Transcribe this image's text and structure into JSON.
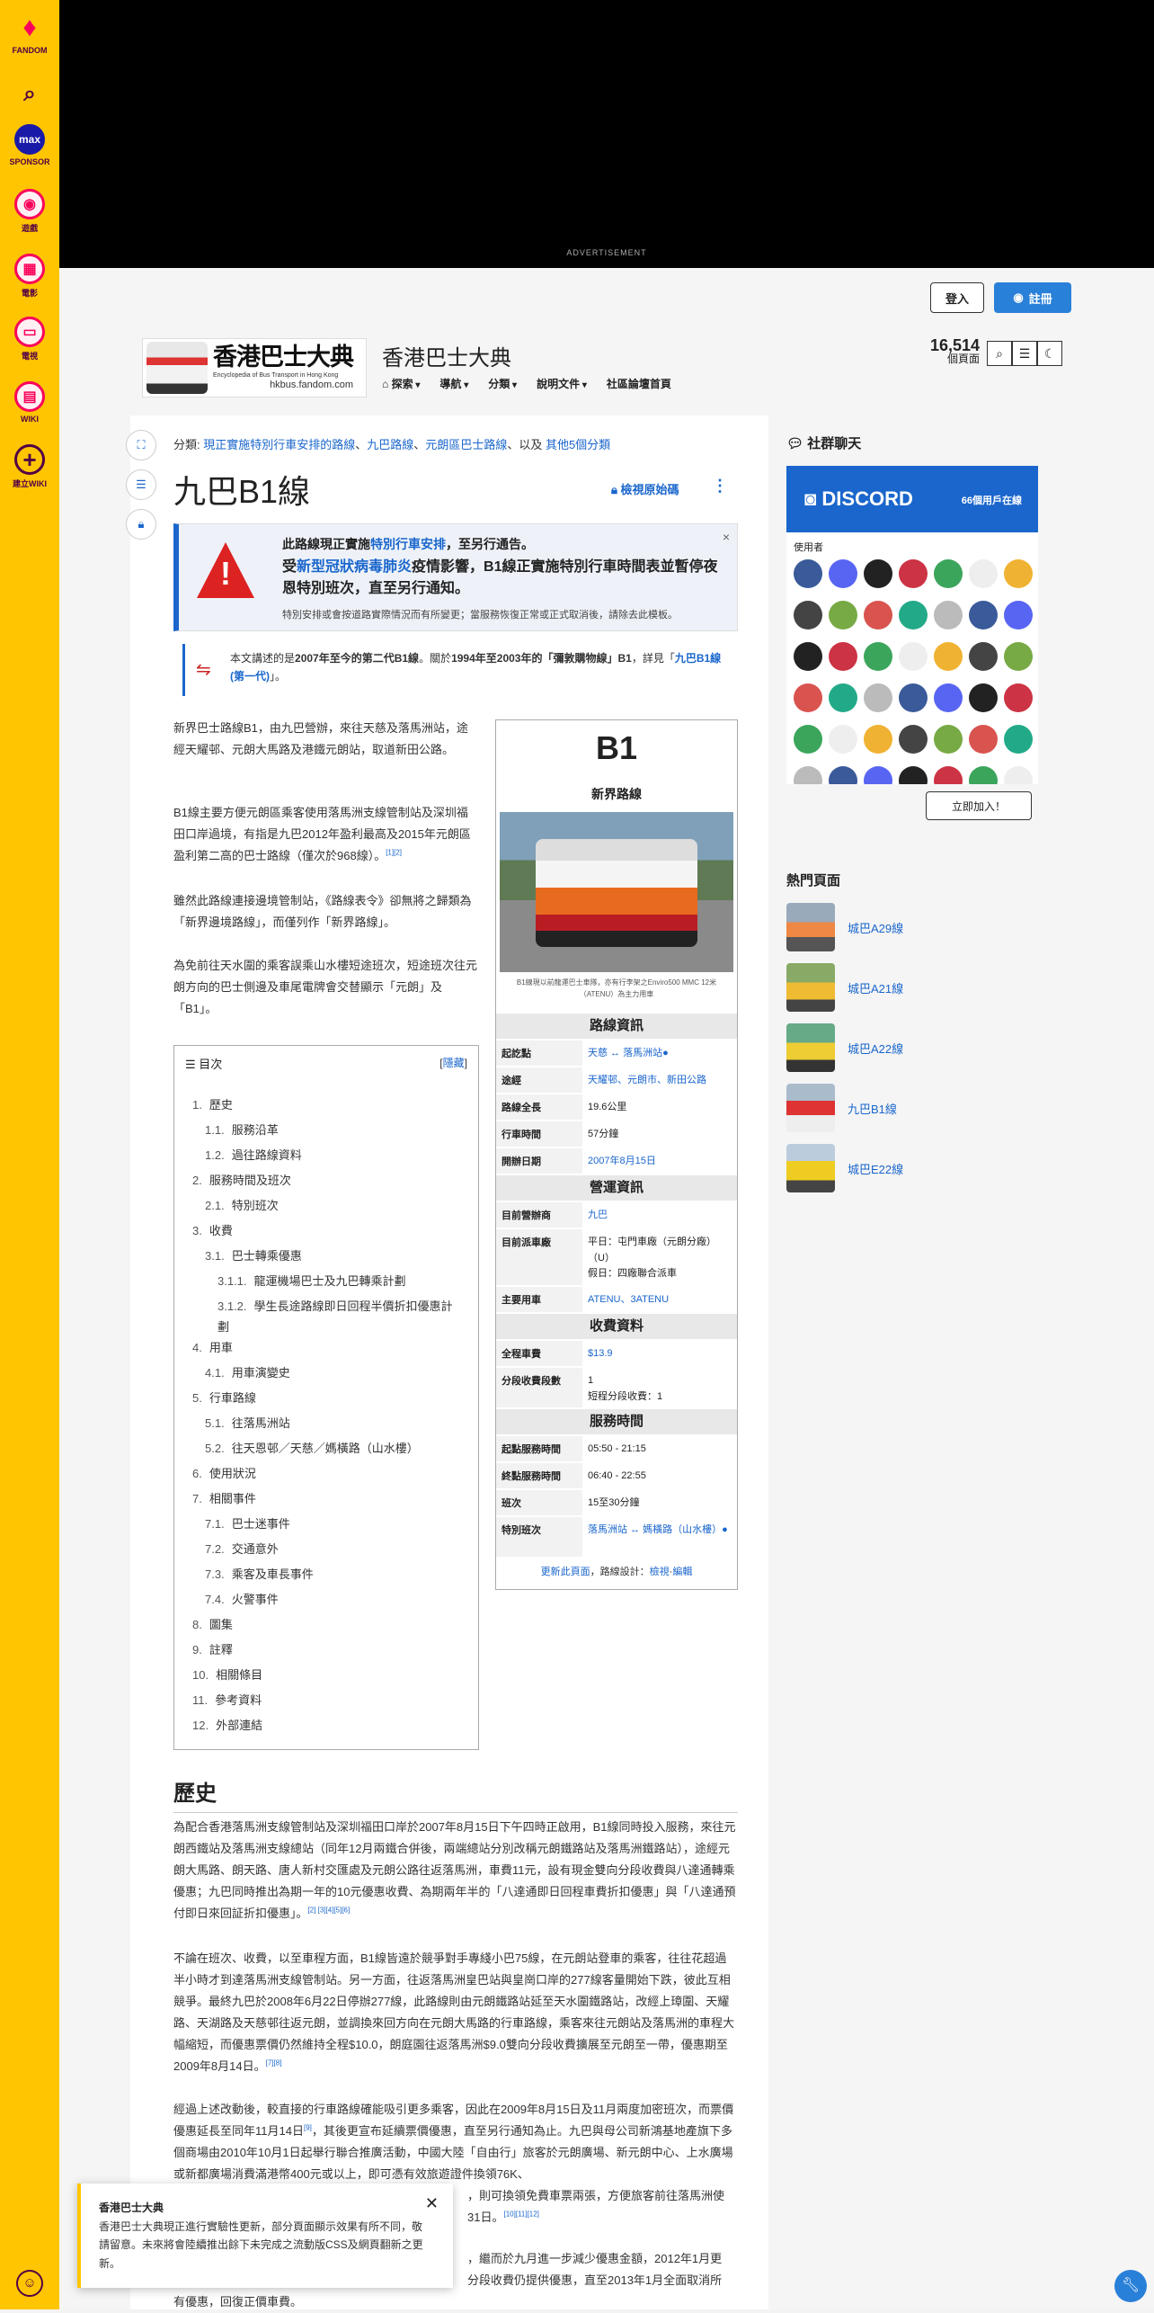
{
  "rail": {
    "fandom": "FANDOM",
    "sponsor": "SPONSOR",
    "max_logo": "max",
    "games": "遊戲",
    "movies": "電影",
    "tv": "電視",
    "wiki": "WIKI",
    "create_wiki": "建立WIKI"
  },
  "ad": {
    "label": "ADVERTISEMENT"
  },
  "header": {
    "login": "登入",
    "register": "註冊",
    "wiki_name": "香港巴士大典",
    "logo_title": "香港巴士大典",
    "logo_subtitle": "Encyclopedia of Bus Transport in Hong Kong",
    "logo_domain": "hkbus.fandom.com",
    "page_count": "16,514",
    "page_count_label": "個頁面",
    "nav": [
      "探索",
      "導航",
      "分類",
      "說明文件",
      "社區論壇首頁"
    ]
  },
  "page": {
    "categories_label": "分類:",
    "categories": [
      "現正實施特別行車安排的路線",
      "九巴路線",
      "元朗區巴士路線"
    ],
    "categories_sep": "、",
    "categories_more_prefix": "、以及 ",
    "categories_more": "其他5個分類",
    "title": "九巴B1線",
    "view_source": "檢視原始碼",
    "more": "⋮"
  },
  "notice": {
    "line1_pre": "此路線現正實施",
    "line1_link": "特別行車安排",
    "line1_post": "，至另行通告。",
    "line2_pre": "受",
    "line2_link": "新型冠狀病毒肺炎",
    "line2_post": "疫情影響，B1線正實施特別行車時間表並暫停夜恩特別班次，直至另行通知。",
    "line3": "特別安排或會按道路實際情況而有所變更；當服務恢復正常或正式取消後，請除去此模板。",
    "close": "×"
  },
  "hatnote": {
    "pre": "本文講述的是",
    "b1": "2007年至今的第二代B1線",
    "mid": "。關於",
    "b2": "1994年至2003年的「彌敦購物線」B1",
    "post": "，詳見「",
    "link": "九巴B1線 (第一代)",
    "end": "」。"
  },
  "intro": {
    "p1": "新界巴士路線B1，由九巴營辦，來往天慈及落馬洲站，途經天耀邨、元朗大馬路及港鐵元朗站，取道新田公路。",
    "p2": "B1線主要方便元朗區乘客使用落馬洲支線管制站及深圳福田口岸過境，有指是九巴2012年盈利最高及2015年元朗區盈利第二高的巴士路線（僅次於968線）。",
    "p2_sup": "[1][2]",
    "p3": "雖然此路線連接邊境管制站，《路線表令》卻無將之歸類為「新界邊境路線」，而僅列作「新界路線」。",
    "p4": "為免前往天水圍的乘客誤乘山水樓短途班次，短途班次往元朗方向的巴士側邊及車尾電牌會交替顯示「元朗」及「B1」。"
  },
  "infobox": {
    "title": "B1",
    "subtitle": "新界路線",
    "caption": "B1線現以前龍運巴士車隊，亦有行李架之Enviro500 MMC 12米（ATENU）為主力用車",
    "sec_route": "路線資訊",
    "sec_ops": "營運資訊",
    "sec_fare": "收費資料",
    "sec_time": "服務時間",
    "rows_route": [
      {
        "k": "起訖點",
        "v": "天慈 ↔ 落馬洲站●"
      },
      {
        "k": "途經",
        "v": "天耀邨、元朗市、新田公路"
      },
      {
        "k": "路線全長",
        "v": "19.6公里"
      },
      {
        "k": "行車時間",
        "v": "57分鐘"
      },
      {
        "k": "開辦日期",
        "v": "2007年8月15日"
      }
    ],
    "rows_ops": [
      {
        "k": "目前營辦商",
        "v": "九巴"
      },
      {
        "k": "目前派車廠",
        "v": "平日：屯門車廠（元朗分廠）（U）\n假日：四廠聯合派車"
      },
      {
        "k": "主要用車",
        "v": "ATENU、3ATENU"
      }
    ],
    "rows_fare": [
      {
        "k": "全程車費",
        "v": "$13.9"
      },
      {
        "k": "分段收費段數",
        "v": "1\n短程分段收費：1"
      }
    ],
    "rows_time": [
      {
        "k": "起點服務時間",
        "v": "05:50 - 21:15"
      },
      {
        "k": "終點服務時間",
        "v": "06:40 - 22:55"
      },
      {
        "k": "班次",
        "v": "15至30分鐘"
      },
      {
        "k": "特別班次",
        "v": "落馬洲站 ↔ 媽橫路（山水樓）●"
      }
    ],
    "foot_link": "更新此頁面",
    "foot_mid": "，路線設計：",
    "foot_view": "檢視",
    "foot_sep": "·",
    "foot_edit": "編輯"
  },
  "toc": {
    "title": "目次",
    "hide": "隱藏",
    "items": [
      {
        "n": "1.",
        "t": "歷史",
        "lvl": 0
      },
      {
        "n": "1.1.",
        "t": "服務沿革",
        "lvl": 1
      },
      {
        "n": "1.2.",
        "t": "過往路線資料",
        "lvl": 1
      },
      {
        "n": "2.",
        "t": "服務時間及班次",
        "lvl": 0
      },
      {
        "n": "2.1.",
        "t": "特別班次",
        "lvl": 1
      },
      {
        "n": "3.",
        "t": "收費",
        "lvl": 0
      },
      {
        "n": "3.1.",
        "t": "巴士轉乘優惠",
        "lvl": 1
      },
      {
        "n": "3.1.1.",
        "t": "龍運機場巴士及九巴轉乘計劃",
        "lvl": 2
      },
      {
        "n": "3.1.2.",
        "t": "學生長途路線即日回程半價折扣優惠計劃",
        "lvl": 2
      },
      {
        "n": "4.",
        "t": "用車",
        "lvl": 0
      },
      {
        "n": "4.1.",
        "t": "用車演變史",
        "lvl": 1
      },
      {
        "n": "5.",
        "t": "行車路線",
        "lvl": 0
      },
      {
        "n": "5.1.",
        "t": "往落馬洲站",
        "lvl": 1
      },
      {
        "n": "5.2.",
        "t": "往天恩邨／天慈／媽橫路（山水樓）",
        "lvl": 1
      },
      {
        "n": "6.",
        "t": "使用狀況",
        "lvl": 0
      },
      {
        "n": "7.",
        "t": "相關事件",
        "lvl": 0
      },
      {
        "n": "7.1.",
        "t": "巴士迷事件",
        "lvl": 1
      },
      {
        "n": "7.2.",
        "t": "交通意外",
        "lvl": 1
      },
      {
        "n": "7.3.",
        "t": "乘客及車長事件",
        "lvl": 1
      },
      {
        "n": "7.4.",
        "t": "火警事件",
        "lvl": 1
      },
      {
        "n": "8.",
        "t": "圖集",
        "lvl": 0
      },
      {
        "n": "9.",
        "t": "註釋",
        "lvl": 0
      },
      {
        "n": "10.",
        "t": "相關條目",
        "lvl": 0
      },
      {
        "n": "11.",
        "t": "參考資料",
        "lvl": 0
      },
      {
        "n": "12.",
        "t": "外部連結",
        "lvl": 0
      }
    ]
  },
  "history": {
    "heading": "歷史",
    "p1": "為配合香港落馬洲支線管制站及深圳福田口岸於2007年8月15日下午四時正啟用，B1線同時投入服務，來往元朗西鐵站及落馬洲支線總站（同年12月兩鐵合併後，兩端總站分別改稱元朗鐵路站及落馬洲鐵路站），途經元朗大馬路、朗天路、唐人新村交匯處及元朗公路往返落馬洲，車費11元，設有現金雙向分段收費與八達通轉乘優惠；九巴同時推出為期一年的10元優惠收費、為期兩年半的「八達通即日回程車費折扣優惠」與「八達通預付即日來回証折扣優惠」。",
    "p1_sup": "[2] [3][4][5][6]",
    "p2": "不論在班次、收費，以至車程方面，B1線皆遠於競爭對手專綫小巴75線，在元朗站登車的乘客，往往花超過半小時才到達落馬洲支線管制站。另一方面，往返落馬洲皇巴站與皇崗口岸的277線客量開始下跌，彼此互相競爭。最終九巴於2008年6月22日停辦277線，此路線則由元朗鐵路站延至天水圍鐵路站，改經上璋圍、天耀路、天湖路及天慈邨往返元朗，並調換來回方向在元朗大馬路的行車路線，乘客來往元朗站及落馬洲的車程大幅縮短，而優惠票價仍然維持全程$10.0，朗庭園往返落馬洲$9.0雙向分段收費擴展至元朗至一帶，優惠期至2009年8月14日。",
    "p2_sup": "[7][8]",
    "p3": "經過上述改動後，較直接的行車路線確能吸引更多乘客，因此在2009年8月15日及11月兩度加密班次，而票價優惠延長至同年11月14日",
    "p3_sup": "[9]",
    "p3_b": "，其後更宣布延續票價優惠，直至另行通知為止。九巴與母公司新鴻基地產旗下多個商場由2010年10月1日起舉行聯合推廣活動，中國大陸「自由行」旅客於元朗廣場、新元朗中心、上水廣場或新都廣場消費滿港幣400元或以上，即可憑有效旅遊證件換領76K、",
    "p3_c": "，則可換領免費車票兩張，方便旅客前往落馬洲使",
    "p3_d": "31日。",
    "p3_sup2": "[10][11][12]",
    "p4_a": "，繼而於九月進一步減少優惠金額，2012年1月更",
    "p4_b": "分段收費仍提供優惠，直至2013年1月全面取消所",
    "p4_c": "有優惠，回復正價車費。"
  },
  "sidebar": {
    "community": "社群聊天",
    "discord_logo": "DISCORD",
    "online_count": "66",
    "online_label": "個用戶在線",
    "users_title": "使用者",
    "join": "立即加入！",
    "popular_title": "熱門頁面",
    "popular": [
      "城巴A29線",
      "城巴A21線",
      "城巴A22線",
      "九巴B1線",
      "城巴E22線"
    ]
  },
  "toast": {
    "title": "香港巴士大典",
    "body": "香港巴士大典現正進行實驗性更新，部分頁面顯示效果有所不同，敬請留意。未來將會陸續推出餘下未完成之流動版CSS及網頁翻新之更新。",
    "close": "✕"
  },
  "colors": {
    "rail": "#ffc500",
    "link": "#1a66cc",
    "accent_pink": "#fa005a",
    "discord": "#1a66cc"
  },
  "icons": [
    "fandom-logo-icon",
    "search-icon",
    "max-icon",
    "games-icon",
    "movies-icon",
    "tv-icon",
    "wiki-icon",
    "plus-icon",
    "expand-icon",
    "toc-icon",
    "lock-icon",
    "search-icon",
    "discussion-icon",
    "theme-icon",
    "wrench-icon"
  ]
}
